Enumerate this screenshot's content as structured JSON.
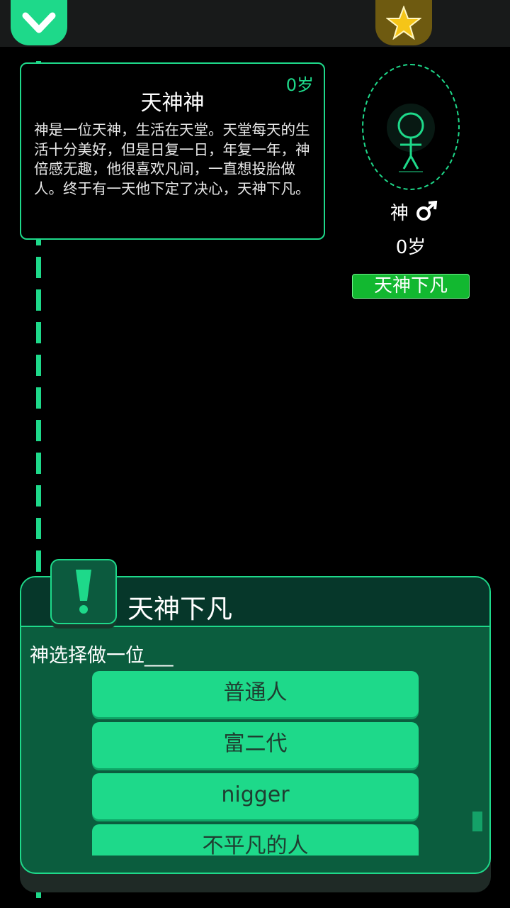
{
  "icons": {
    "menu": "chevron-down-icon",
    "achievements": "star-icon",
    "alert": "exclamation-icon",
    "gender": "male-icon"
  },
  "colors": {
    "accent": "#1ed98a",
    "panel": "#0b5d3e",
    "tag": "#12b830",
    "star": "#f5c518"
  },
  "story": {
    "age": "0岁",
    "title": "天神神",
    "text": "神是一位天神，生活在天堂。天堂每天的生活十分美好，但是日复一日，年复一年，神倍感无趣，他很喜欢凡间，一直想投胎做人。终于有一天他下定了决心，天神下凡。"
  },
  "character": {
    "name": "神",
    "age": "0岁",
    "tag": "天神下凡"
  },
  "event": {
    "title": "天神下凡",
    "question": "神选择做一位___",
    "options": [
      "普通人",
      "富二代",
      "nigger",
      "不平凡的人"
    ]
  }
}
